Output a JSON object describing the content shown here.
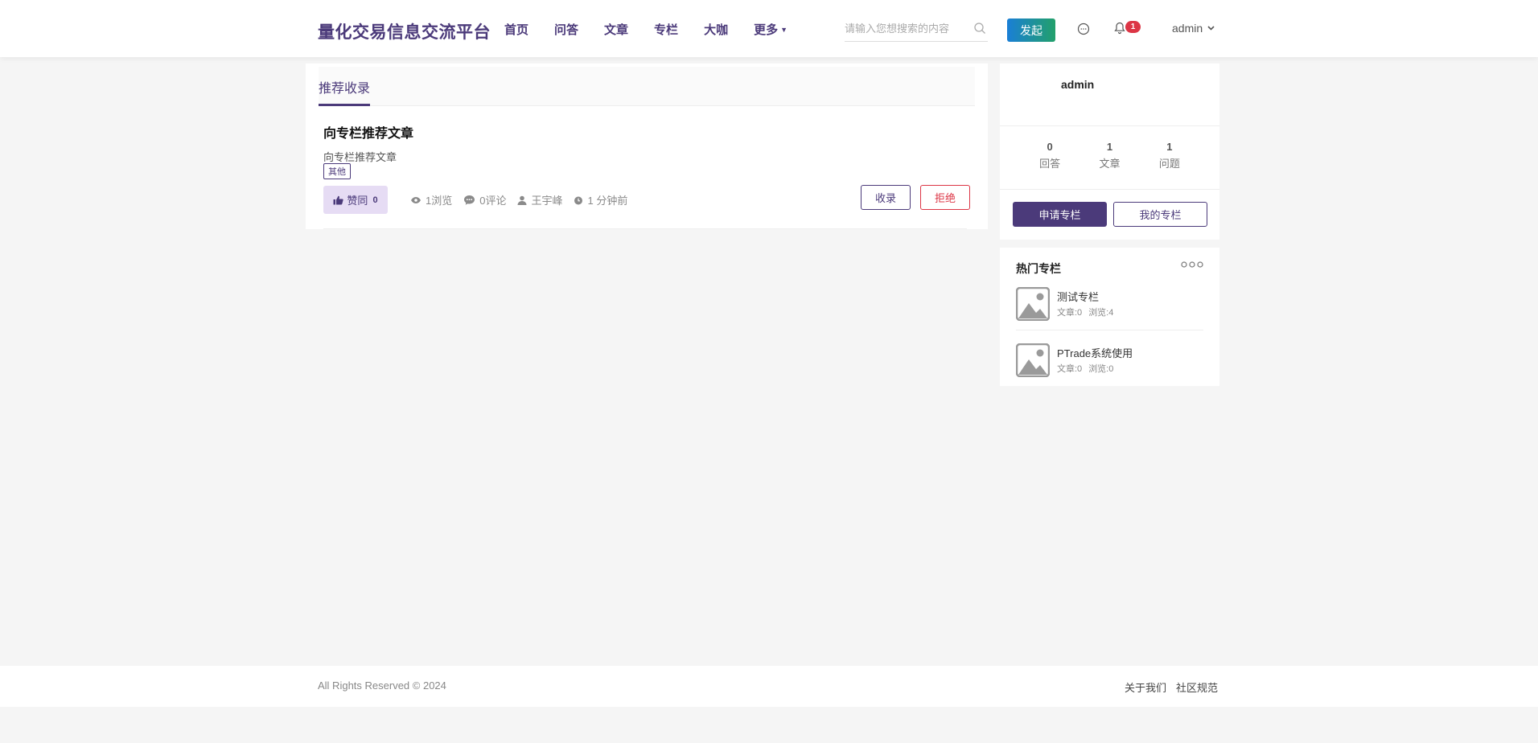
{
  "header": {
    "brand": "量化交易信息交流平台",
    "nav": [
      {
        "label": "首页"
      },
      {
        "label": "问答"
      },
      {
        "label": "文章"
      },
      {
        "label": "专栏"
      },
      {
        "label": "大咖"
      },
      {
        "label": "更多"
      }
    ],
    "search_placeholder": "请输入您想搜索的内容",
    "publish_label": "发起",
    "notification_count": "1",
    "user": "admin"
  },
  "main": {
    "tab": "推荐收录",
    "article": {
      "title": "向专栏推荐文章",
      "summary": "向专栏推荐文章",
      "tag": "其他",
      "like_label": "赞同",
      "like_count": "0",
      "views": "1浏览",
      "comments": "0评论",
      "author": "王宇峰",
      "time": "1 分钟前",
      "accept_label": "收录",
      "reject_label": "拒绝"
    }
  },
  "profile": {
    "name": "admin",
    "stats": [
      {
        "num": "0",
        "label": "回答"
      },
      {
        "num": "1",
        "label": "文章"
      },
      {
        "num": "1",
        "label": "问题"
      }
    ],
    "apply_label": "申请专栏",
    "mine_label": "我的专栏"
  },
  "hot_columns": {
    "title": "热门专栏",
    "items": [
      {
        "name": "测试专栏",
        "articles": "文章:0",
        "views": "浏览:4"
      },
      {
        "name": "PTrade系统使用",
        "articles": "文章:0",
        "views": "浏览:0"
      }
    ]
  },
  "footer": {
    "copyright": "All Rights Reserved © 2024",
    "links": [
      {
        "label": "关于我们"
      },
      {
        "label": "社区规范"
      }
    ]
  },
  "colors": {
    "primary": "#4b3a7a",
    "danger": "#dc3545",
    "publish_gradient_start": "#1a7fd6",
    "publish_gradient_end": "#22a06b"
  },
  "icons": [
    "search-icon",
    "chat-icon",
    "bell-icon",
    "chevron-down-icon",
    "thumbs-up-icon",
    "eye-icon",
    "comment-icon",
    "user-icon",
    "clock-icon",
    "more-icon",
    "image-placeholder-icon"
  ]
}
